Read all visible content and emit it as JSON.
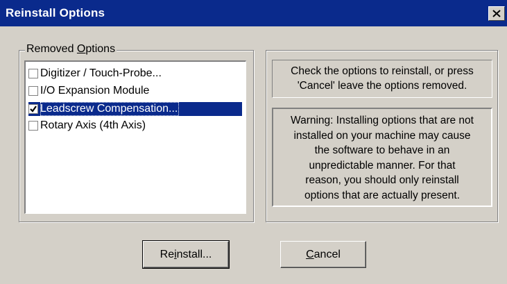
{
  "window": {
    "title": "Reinstall Options",
    "close_icon": "close-icon"
  },
  "group": {
    "label_prefix": "Removed ",
    "label_accel": "O",
    "label_suffix": "ptions"
  },
  "options": [
    {
      "label": "Digitizer / Touch-Probe...",
      "checked": false,
      "selected": false
    },
    {
      "label": "I/O Expansion Module",
      "checked": false,
      "selected": false
    },
    {
      "label": "Leadscrew Compensation...",
      "checked": true,
      "selected": true
    },
    {
      "label": "Rotary Axis (4th Axis)",
      "checked": false,
      "selected": false
    }
  ],
  "info": {
    "line1": "Check the options to reinstall, or press",
    "line2": "'Cancel' leave the options removed."
  },
  "warning": {
    "line1": "Warning: Installing options that are not",
    "line2": "installed on your machine may cause",
    "line3": "the software to behave in an",
    "line4": "unpredictable manner.  For that",
    "line5": "reason, you should only reinstall",
    "line6": "options that are actually present."
  },
  "buttons": {
    "reinstall_pre": "Re",
    "reinstall_accel": "i",
    "reinstall_post": "nstall...",
    "cancel_accel": "C",
    "cancel_post": "ancel"
  },
  "colors": {
    "titlebar": "#0a2a8c",
    "selection": "#0a2a8c",
    "face": "#d4d0c8"
  }
}
